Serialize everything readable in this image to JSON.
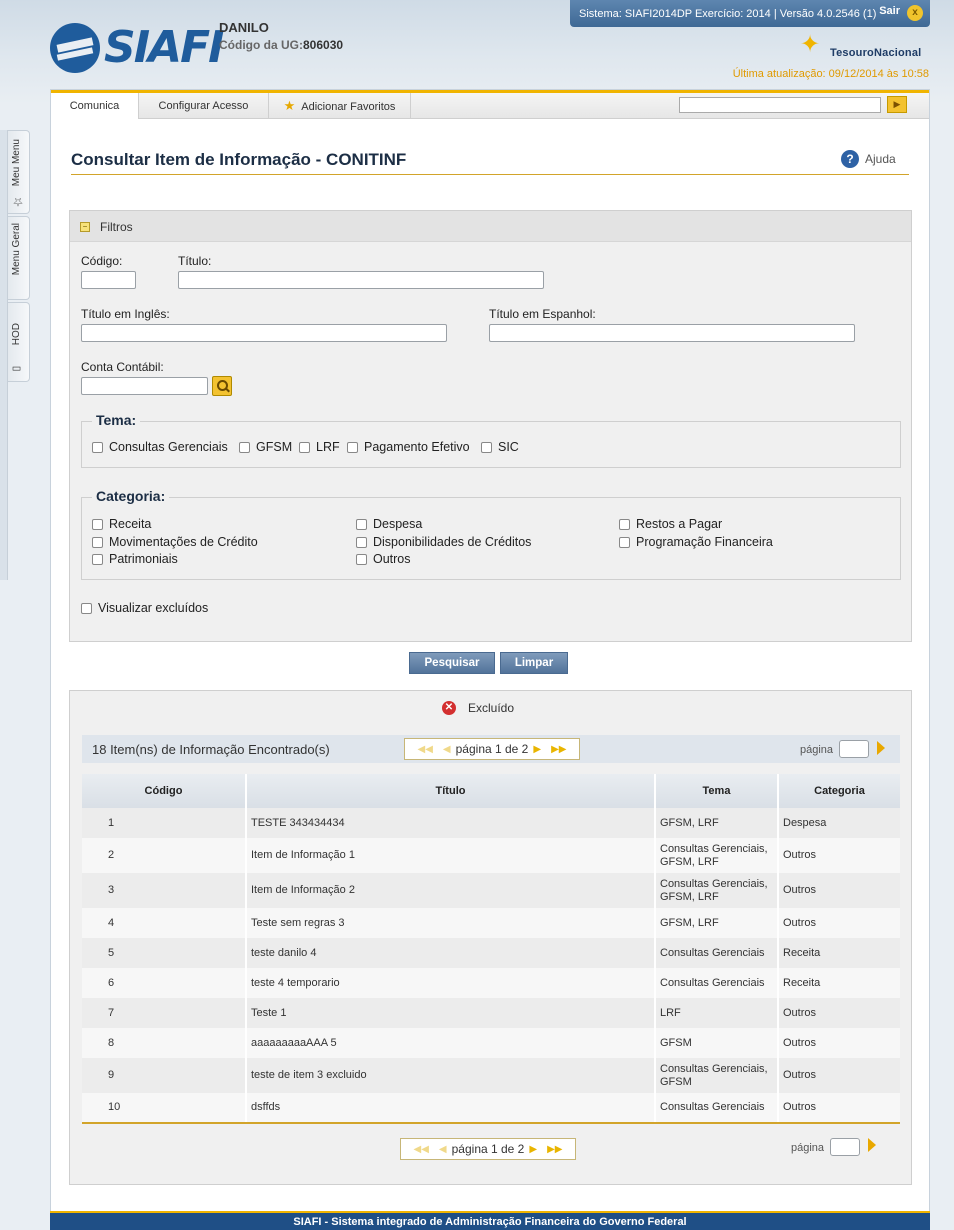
{
  "header": {
    "logo_text": "SIAFI",
    "user_name": "DANILO",
    "ug_label": "Código da UG:",
    "ug_value": "806030",
    "system_info": "Sistema: SIAFI2014DP Exercício: 2014 | Versão 4.0.2546 (1)",
    "exit_label": "Sair",
    "tesouro_text": "TesouroNacional",
    "last_update": "Última atualização: 09/12/2014 às 10:58"
  },
  "side_tabs": [
    "Meu Menu",
    "Menu Geral",
    "HOD"
  ],
  "topnav": {
    "tabs": [
      "Comunica",
      "Configurar Acesso",
      "Adicionar Favoritos"
    ]
  },
  "page": {
    "title": "Consultar Item de Informação - CONITINF",
    "help_label": "Ajuda"
  },
  "filters": {
    "section_title": "Filtros",
    "codigo_label": "Código:",
    "titulo_label": "Título:",
    "titulo_ingles_label": "Título em Inglês:",
    "titulo_espanhol_label": "Título em Espanhol:",
    "conta_contabil_label": "Conta Contábil:",
    "tema_label": "Tema:",
    "tema_options": [
      "Consultas Gerenciais",
      "GFSM",
      "LRF",
      "Pagamento Efetivo",
      "SIC"
    ],
    "categoria_label": "Categoria:",
    "categoria_options": [
      "Receita",
      "Despesa",
      "Restos a Pagar",
      "Movimentações de Crédito",
      "Disponibilidades de Créditos",
      "Programação Financeira",
      "Patrimoniais",
      "Outros"
    ],
    "visualizar_excluidos_label": "Visualizar excluídos"
  },
  "actions": {
    "search_label": "Pesquisar",
    "clear_label": "Limpar"
  },
  "results": {
    "legend_excluded": "Excluído",
    "found_text": "18 Item(ns) de Informação Encontrado(s)",
    "page_text": "página 1 de 2",
    "goto_label": "página",
    "columns": [
      "Código",
      "Título",
      "Tema",
      "Categoria"
    ],
    "rows": [
      {
        "codigo": "1",
        "titulo": "TESTE 343434434",
        "tema": "GFSM, LRF",
        "categoria": "Despesa"
      },
      {
        "codigo": "2",
        "titulo": "Item de Informação 1",
        "tema": "Consultas Gerenciais, GFSM, LRF",
        "categoria": "Outros"
      },
      {
        "codigo": "3",
        "titulo": "Item de Informação 2",
        "tema": "Consultas Gerenciais, GFSM, LRF",
        "categoria": "Outros"
      },
      {
        "codigo": "4",
        "titulo": "Teste sem regras 3",
        "tema": "GFSM, LRF",
        "categoria": "Outros"
      },
      {
        "codigo": "5",
        "titulo": "teste danilo 4",
        "tema": "Consultas Gerenciais",
        "categoria": "Receita"
      },
      {
        "codigo": "6",
        "titulo": "teste 4 temporario",
        "tema": "Consultas Gerenciais",
        "categoria": "Receita"
      },
      {
        "codigo": "7",
        "titulo": "Teste 1",
        "tema": "LRF",
        "categoria": "Outros"
      },
      {
        "codigo": "8",
        "titulo": "aaaaaaaaaAAA 5",
        "tema": "GFSM",
        "categoria": "Outros"
      },
      {
        "codigo": "9",
        "titulo": "teste de item 3 excluido",
        "tema": "Consultas Gerenciais, GFSM",
        "categoria": "Outros"
      },
      {
        "codigo": "10",
        "titulo": "dsffds",
        "tema": "Consultas Gerenciais",
        "categoria": "Outros"
      }
    ]
  },
  "footer": {
    "text": "SIAFI - Sistema integrado de Administração Financeira do Governo Federal"
  },
  "colors": {
    "brand_blue": "#1f5c9c",
    "accent_gold": "#f0b400",
    "button_blue": "#52739a"
  }
}
